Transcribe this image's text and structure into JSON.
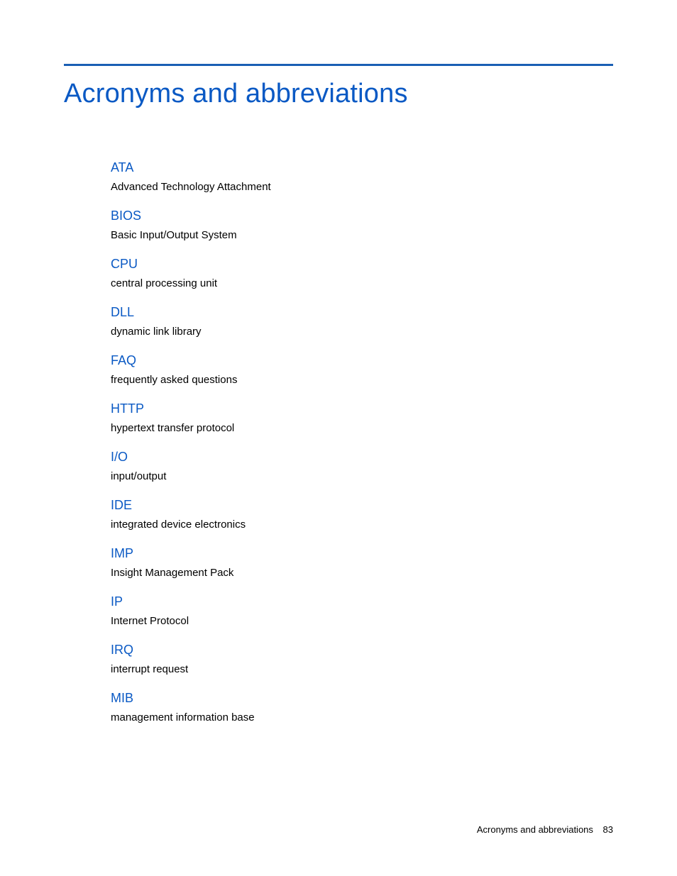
{
  "title": "Acronyms and abbreviations",
  "entries": [
    {
      "term": "ATA",
      "definition": "Advanced Technology Attachment"
    },
    {
      "term": "BIOS",
      "definition": "Basic Input/Output System"
    },
    {
      "term": "CPU",
      "definition": "central processing unit"
    },
    {
      "term": "DLL",
      "definition": "dynamic link library"
    },
    {
      "term": "FAQ",
      "definition": "frequently asked questions"
    },
    {
      "term": "HTTP",
      "definition": "hypertext transfer protocol"
    },
    {
      "term": "I/O",
      "definition": "input/output"
    },
    {
      "term": "IDE",
      "definition": "integrated device electronics"
    },
    {
      "term": "IMP",
      "definition": "Insight Management Pack"
    },
    {
      "term": "IP",
      "definition": "Internet Protocol"
    },
    {
      "term": "IRQ",
      "definition": "interrupt request"
    },
    {
      "term": "MIB",
      "definition": "management information base"
    }
  ],
  "footer": {
    "section": "Acronyms and abbreviations",
    "page_number": "83"
  }
}
